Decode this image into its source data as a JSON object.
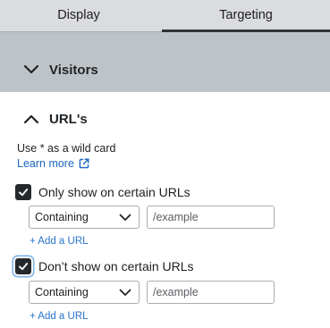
{
  "tabs": [
    {
      "label": "Display",
      "active": false
    },
    {
      "label": "Targeting",
      "active": true
    }
  ],
  "visitors": {
    "title": "Visitors",
    "expanded": false
  },
  "urls": {
    "title": "URL's",
    "expanded": true,
    "hint": "Use * as a wild card",
    "learn_more": "Learn more",
    "rules": [
      {
        "label": "Only show on certain URLs",
        "checked": true,
        "match": "Containing",
        "placeholder": "/example",
        "add_label": "+ Add a URL"
      },
      {
        "label": "Don’t show on certain URLs",
        "checked": true,
        "match": "Containing",
        "placeholder": "/example",
        "add_label": "+ Add a URL"
      }
    ]
  },
  "colors": {
    "overlay": "#bec3c7",
    "link": "#1a66c2",
    "checkbox": "#26292c"
  }
}
